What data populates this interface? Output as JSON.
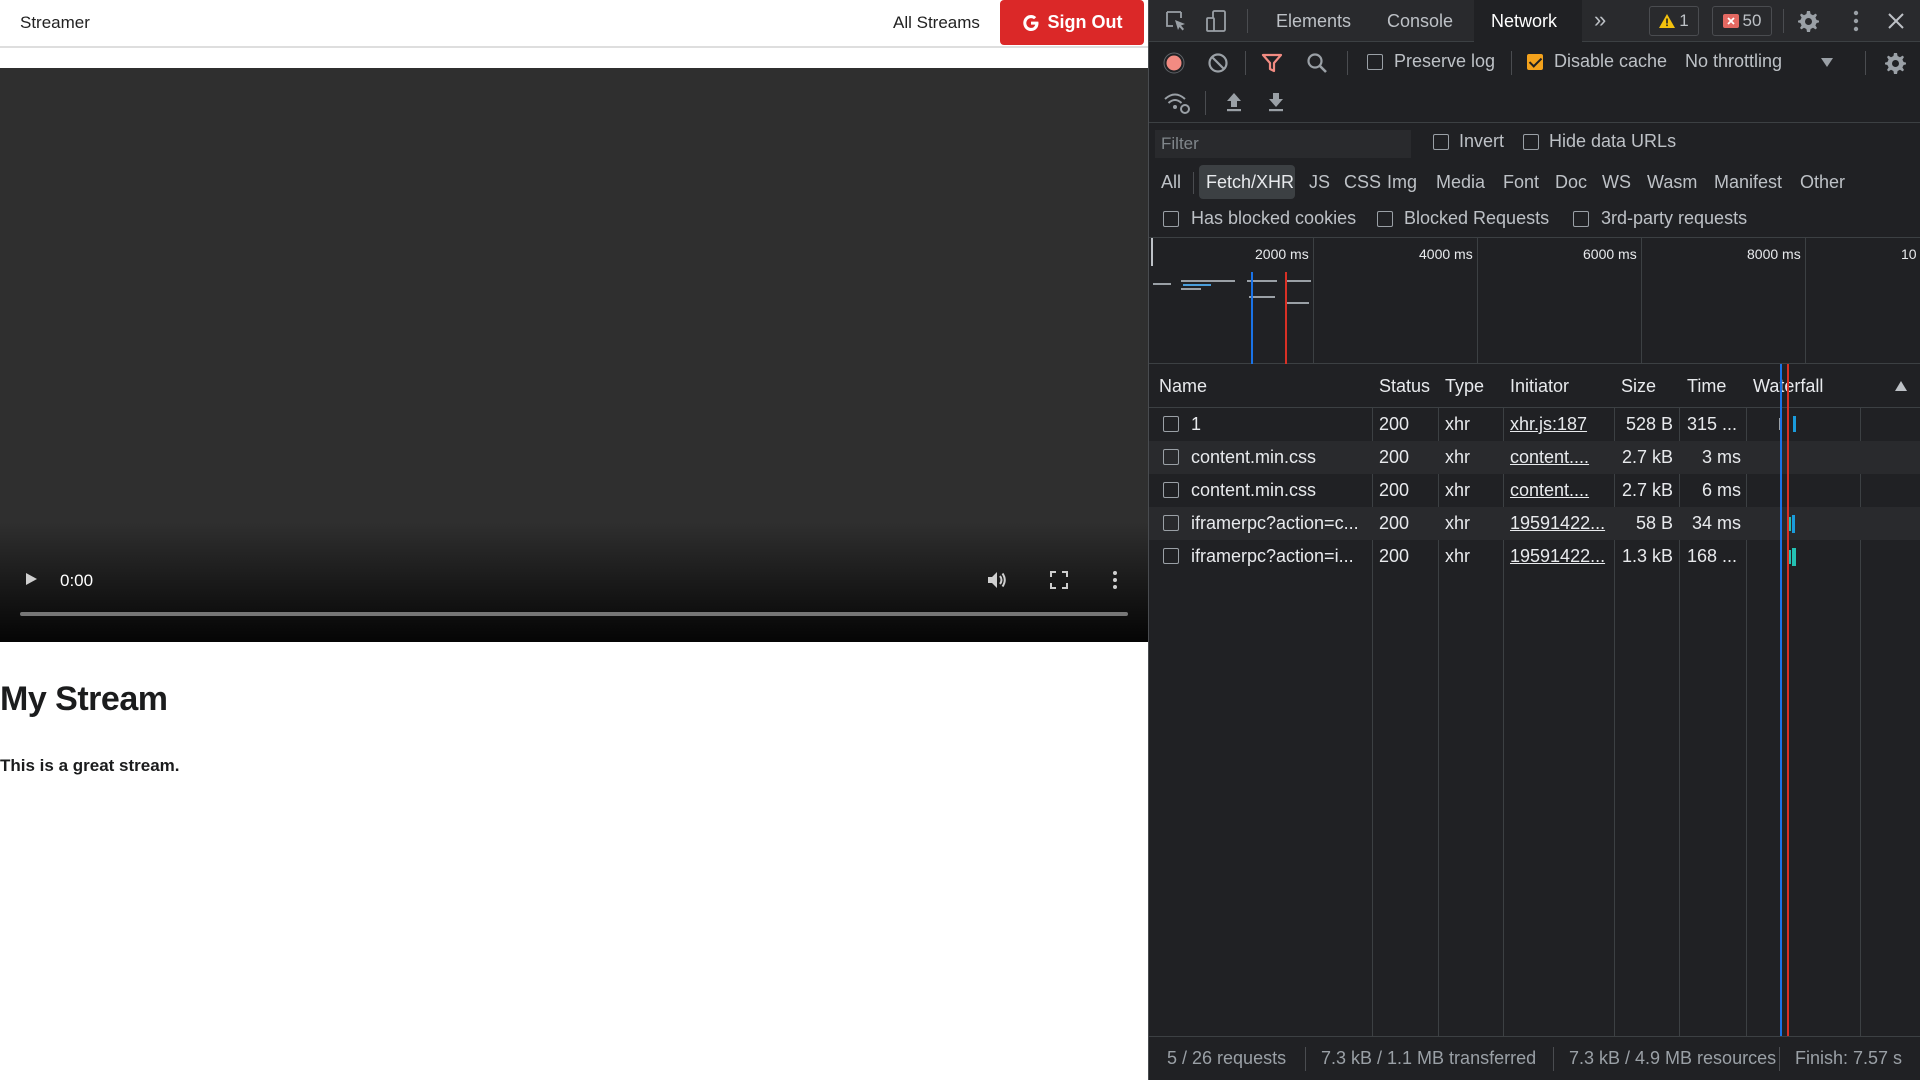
{
  "page": {
    "brand": "Streamer",
    "nav_all_streams": "All Streams",
    "signout_label": "Sign Out",
    "video_time": "0:00",
    "stream_title": "My Stream",
    "stream_description": "This is a great stream.",
    "colors": {
      "signout_bg": "#db2828",
      "video_bg": "#2f2f2f"
    }
  },
  "devtools": {
    "tabs": [
      "Elements",
      "Console",
      "Network"
    ],
    "active_tab": "Network",
    "more_tabs": "»",
    "warnings_count": "1",
    "errors_count": "50",
    "toolbar": {
      "preserve_log": "Preserve log",
      "preserve_log_checked": false,
      "disable_cache": "Disable cache",
      "disable_cache_checked": true,
      "throttling": "No throttling"
    },
    "filter": {
      "placeholder": "Filter",
      "invert": "Invert",
      "hide_data_urls": "Hide data URLs"
    },
    "types": [
      "All",
      "Fetch/XHR",
      "JS",
      "CSS",
      "Img",
      "Media",
      "Font",
      "Doc",
      "WS",
      "Wasm",
      "Manifest",
      "Other"
    ],
    "active_type": "Fetch/XHR",
    "extra_filters": {
      "blocked_cookies": "Has blocked cookies",
      "blocked_requests": "Blocked Requests",
      "third_party": "3rd-party requests"
    },
    "overview_ticks": [
      "2000 ms",
      "4000 ms",
      "6000 ms",
      "8000 ms",
      "10"
    ],
    "columns": {
      "name": "Name",
      "status": "Status",
      "type": "Type",
      "initiator": "Initiator",
      "size": "Size",
      "time": "Time",
      "waterfall": "Waterfall"
    },
    "rows": [
      {
        "name": "1",
        "status": "200",
        "type": "xhr",
        "initiator": "xhr.js:187",
        "size": "528 B",
        "time": "315 ..."
      },
      {
        "name": "content.min.css",
        "status": "200",
        "type": "xhr",
        "initiator": "content....",
        "size": "2.7 kB",
        "time": "3 ms"
      },
      {
        "name": "content.min.css",
        "status": "200",
        "type": "xhr",
        "initiator": "content....",
        "size": "2.7 kB",
        "time": "6 ms"
      },
      {
        "name": "iframerpc?action=c...",
        "status": "200",
        "type": "xhr",
        "initiator": "19591422...",
        "size": "58 B",
        "time": "34 ms"
      },
      {
        "name": "iframerpc?action=i...",
        "status": "200",
        "type": "xhr",
        "initiator": "19591422...",
        "size": "1.3 kB",
        "time": "168 ..."
      }
    ],
    "status_bar": {
      "requests": "5 / 26 requests",
      "transferred": "7.3 kB / 1.1 MB transferred",
      "resources": "7.3 kB / 4.9 MB resources",
      "finish": "Finish: 7.57 s"
    },
    "colors": {
      "bg": "#202124",
      "record": "#f28b82",
      "filter_icon": "#f28b82",
      "accent": "#f4a21c",
      "blue": "#1a73e8",
      "red": "#d93025"
    }
  }
}
